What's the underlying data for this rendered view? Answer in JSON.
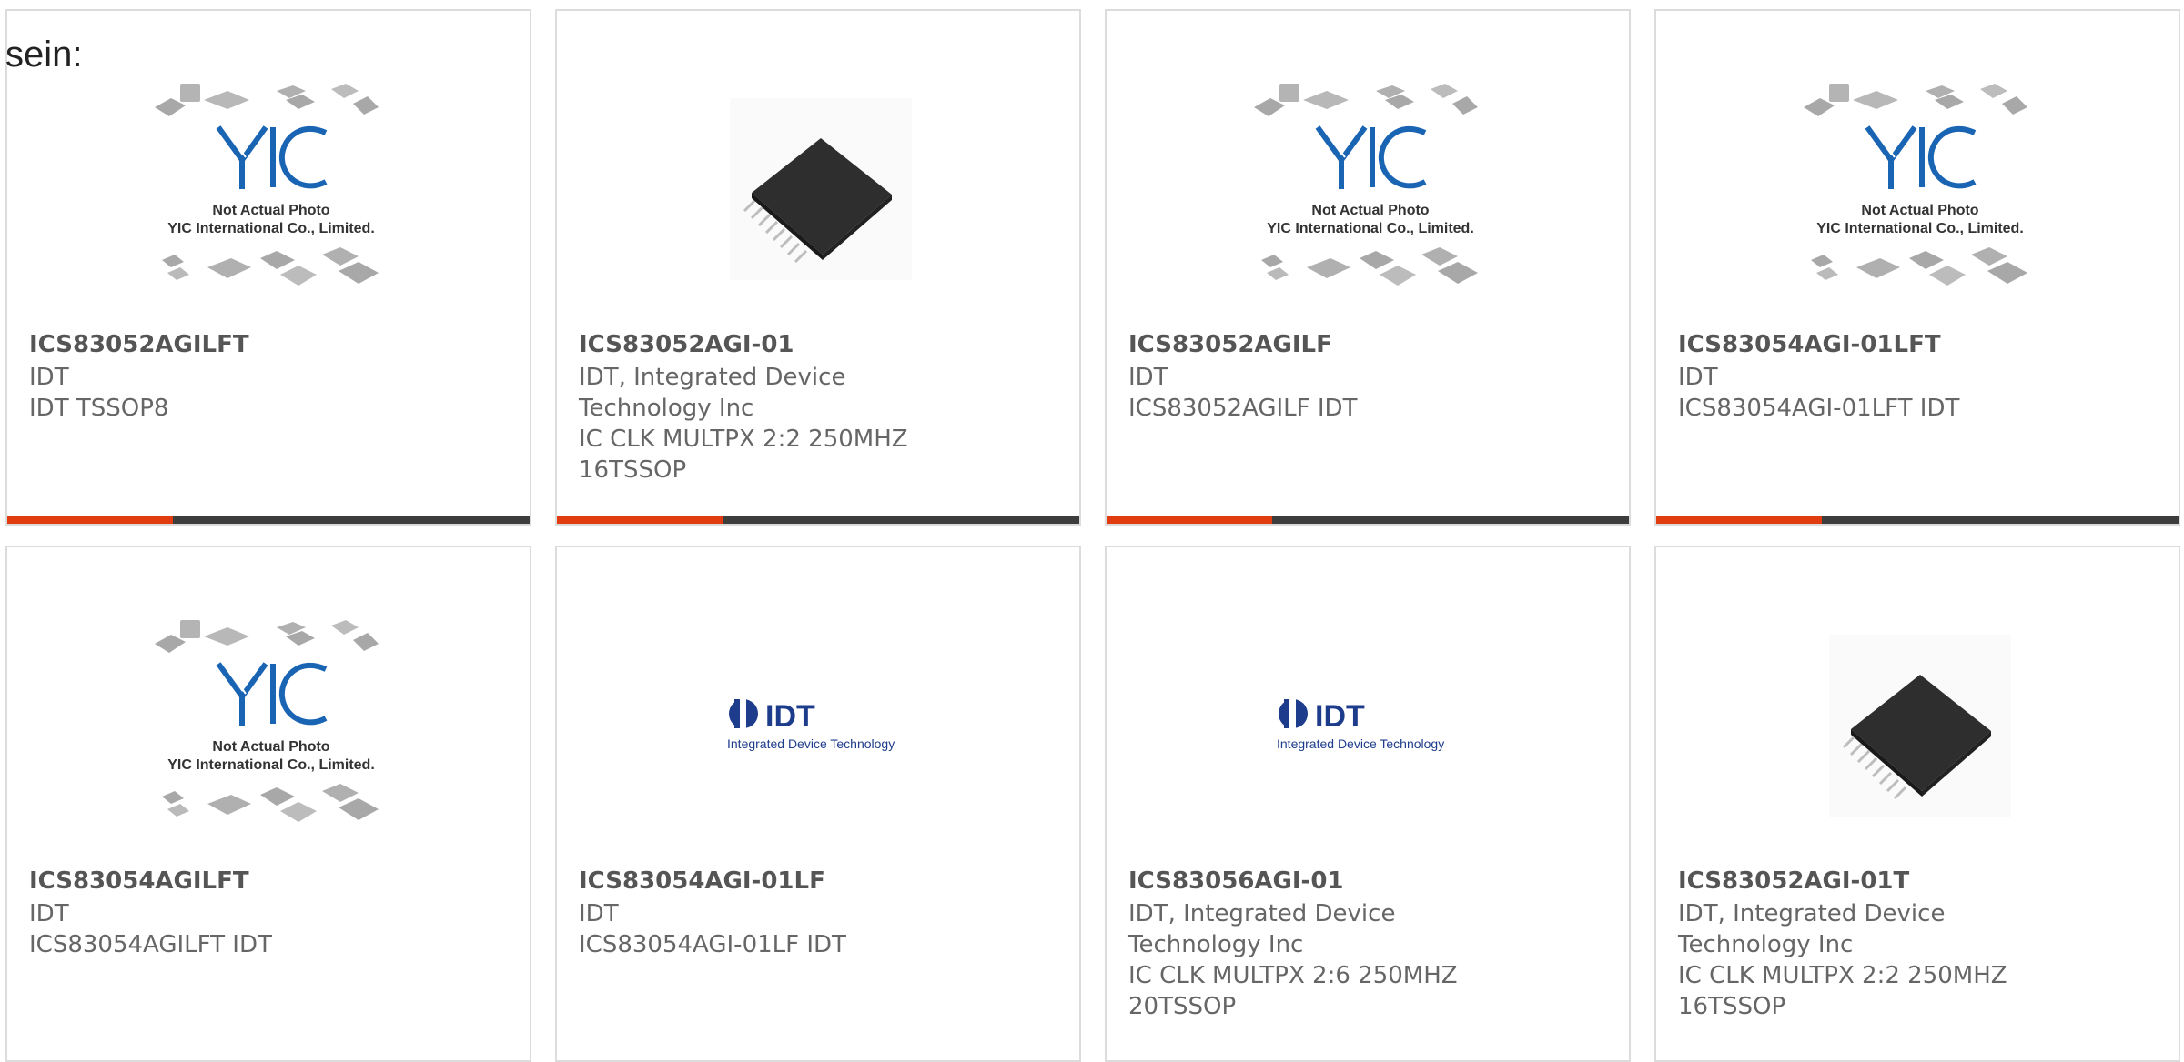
{
  "header": {
    "text": "sein:"
  },
  "placeholder": {
    "line1": "Not Actual Photo",
    "line2": "YIC International Co., Limited.",
    "logo": "YIC"
  },
  "idt_logo": {
    "brand": "IDT",
    "tagline": "Integrated Device Technology"
  },
  "colors": {
    "accent": "#e03c10",
    "bar": "#3d3d3d",
    "yic_blue": "#1a64b4",
    "idt_blue": "#1e3c8c"
  },
  "cards": [
    {
      "part": "ICS83052AGILFT",
      "image": "yic-placeholder",
      "lines": [
        "IDT",
        "IDT TSSOP8"
      ]
    },
    {
      "part": "ICS83052AGI-01",
      "image": "chip-photo",
      "lines": [
        "IDT, Integrated Device",
        "Technology Inc",
        "IC CLK MULTPX 2:2 250MHZ",
        "16TSSOP"
      ]
    },
    {
      "part": "ICS83052AGILF",
      "image": "yic-placeholder",
      "lines": [
        "IDT",
        "ICS83052AGILF IDT"
      ]
    },
    {
      "part": "ICS83054AGI-01LFT",
      "image": "yic-placeholder",
      "lines": [
        "IDT",
        "ICS83054AGI-01LFT IDT"
      ]
    },
    {
      "part": "ICS83054AGILFT",
      "image": "yic-placeholder",
      "lines": [
        "IDT",
        "ICS83054AGILFT IDT"
      ]
    },
    {
      "part": "ICS83054AGI-01LF",
      "image": "idt-logo",
      "lines": [
        "IDT",
        "ICS83054AGI-01LF IDT"
      ]
    },
    {
      "part": "ICS83056AGI-01",
      "image": "idt-logo",
      "lines": [
        "IDT, Integrated Device",
        "Technology Inc",
        "IC CLK MULTPX 2:6 250MHZ",
        "20TSSOP"
      ]
    },
    {
      "part": "ICS83052AGI-01T",
      "image": "chip-photo",
      "lines": [
        "IDT, Integrated Device",
        "Technology Inc",
        "IC CLK MULTPX 2:2 250MHZ",
        "16TSSOP"
      ]
    }
  ]
}
